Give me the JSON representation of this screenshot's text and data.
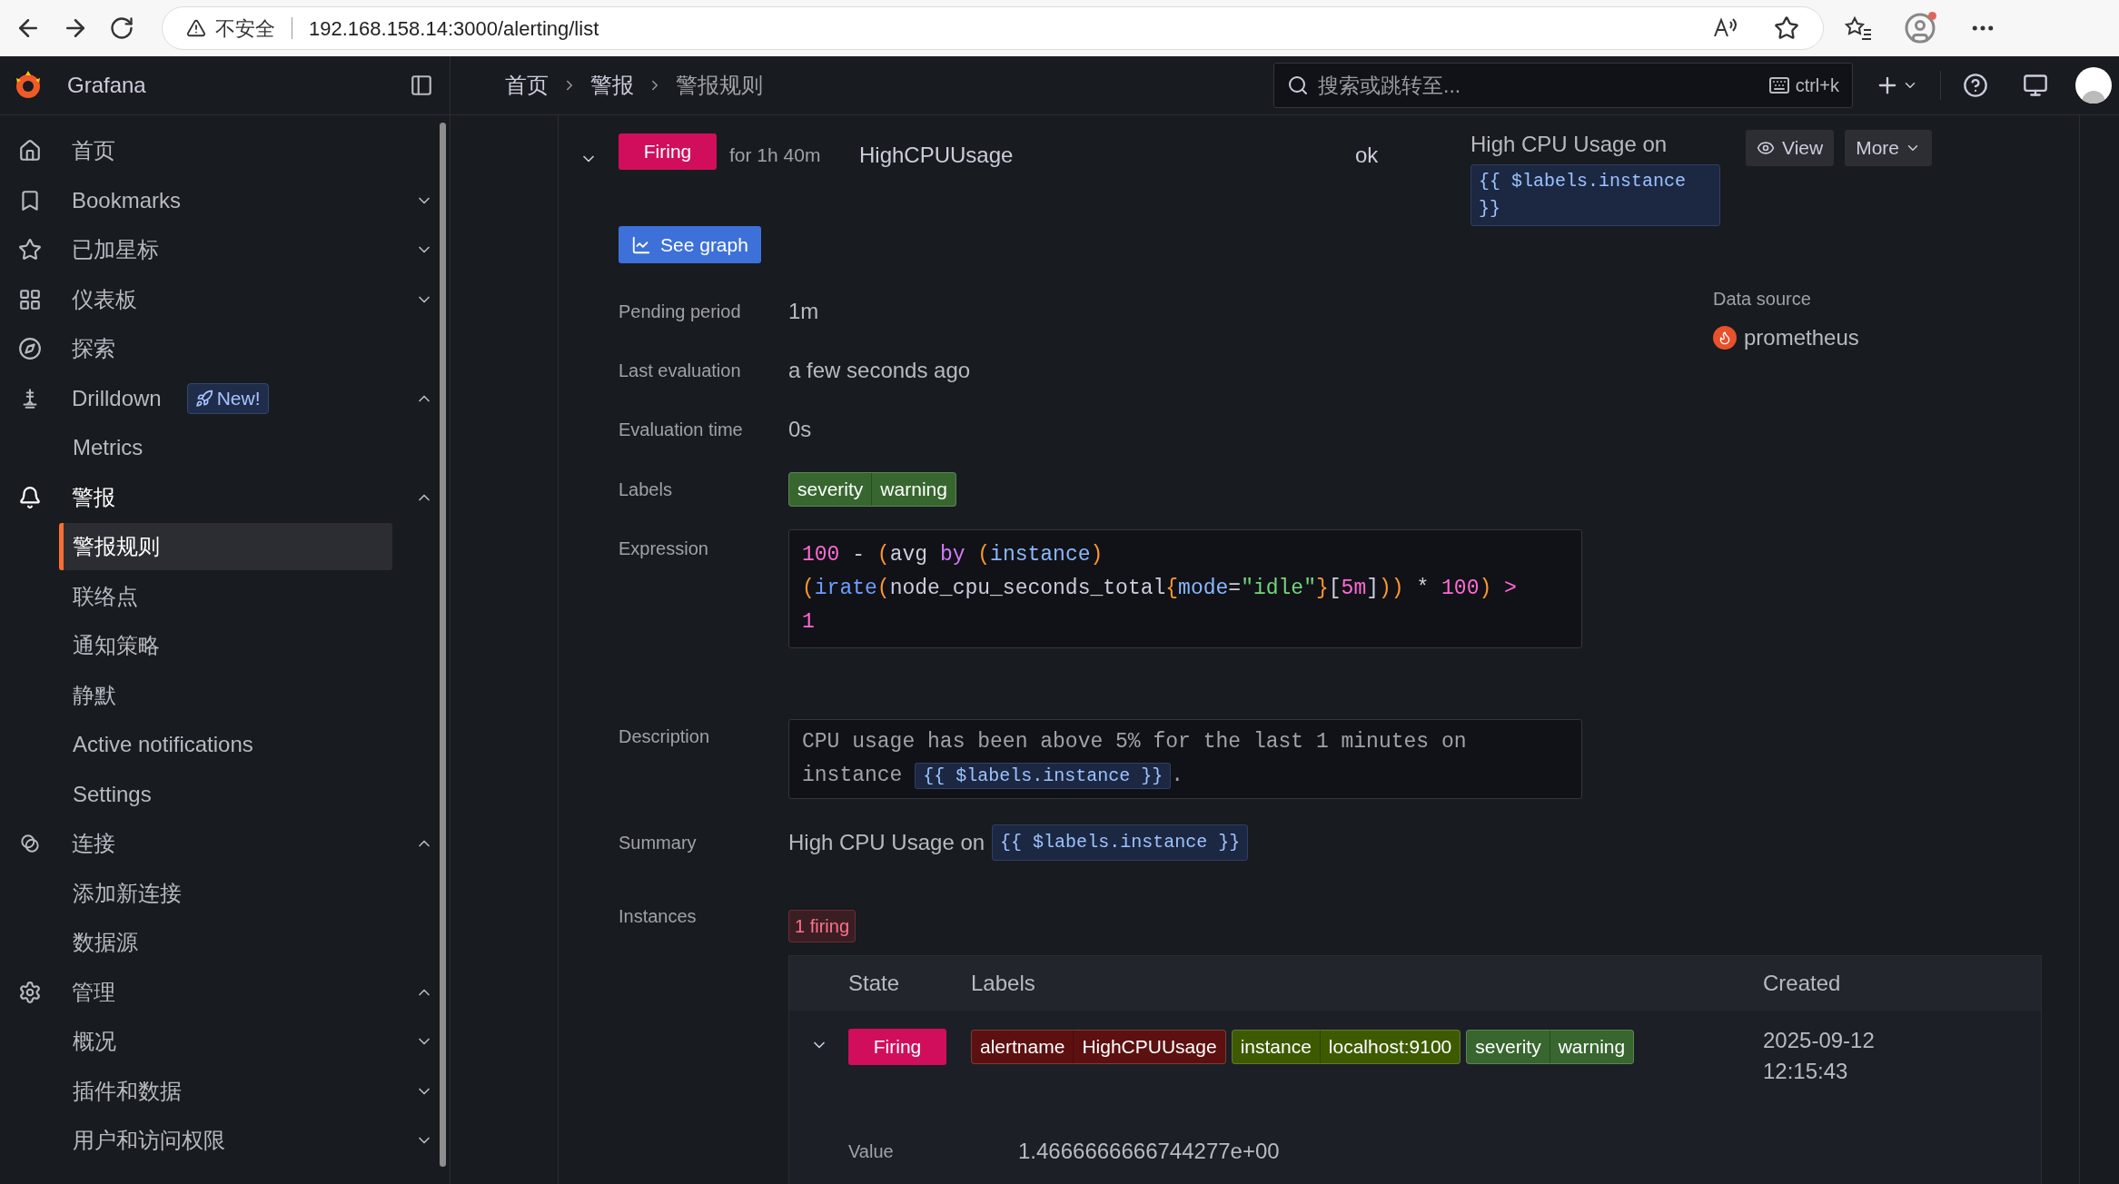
{
  "browser": {
    "security": "不安全",
    "url": "192.168.158.14:3000/alerting/list"
  },
  "header": {
    "app_name": "Grafana",
    "breadcrumbs": [
      "首页",
      "警报",
      "警报规则"
    ],
    "search": {
      "placeholder": "搜索或跳转至..."
    },
    "shortcut": "ctrl+k"
  },
  "sidebar": {
    "items": [
      {
        "label": "首页",
        "selected": false
      },
      {
        "label": "Bookmarks",
        "selected": false,
        "expanded": false
      },
      {
        "label": "已加星标",
        "selected": false,
        "expanded": false
      },
      {
        "label": "仪表板",
        "selected": false,
        "expanded": false
      },
      {
        "label": "探索",
        "selected": false
      },
      {
        "label": "Drilldown",
        "selected": false,
        "badge": "New!",
        "expanded": true,
        "children": [
          {
            "label": "Metrics",
            "selected": false
          }
        ]
      },
      {
        "label": "警报",
        "selected": true,
        "expanded": true,
        "children": [
          {
            "label": "警报规则",
            "selected": true
          },
          {
            "label": "联络点",
            "selected": false
          },
          {
            "label": "通知策略",
            "selected": false
          },
          {
            "label": "静默",
            "selected": false
          },
          {
            "label": "Active notifications",
            "selected": false
          },
          {
            "label": "Settings",
            "selected": false
          }
        ]
      },
      {
        "label": "连接",
        "selected": false,
        "expanded": true,
        "children": [
          {
            "label": "添加新连接",
            "selected": false
          },
          {
            "label": "数据源",
            "selected": false
          }
        ]
      },
      {
        "label": "管理",
        "selected": false,
        "expanded": true,
        "children": [
          {
            "label": "概况",
            "selected": false,
            "expanded": false
          },
          {
            "label": "插件和数据",
            "selected": false,
            "expanded": false
          },
          {
            "label": "用户和访问权限",
            "selected": false,
            "expanded": false
          }
        ]
      }
    ]
  },
  "rule": {
    "expanded": true,
    "state": "Firing",
    "duration": "for 1h 40m",
    "name": "HighCPUUsage",
    "health": "ok",
    "summary_text": "High CPU Usage on",
    "summary_code": "{{ $labels.instance }}",
    "buttons": [
      "View",
      "More"
    ],
    "see_graph": "See graph",
    "fields": [
      {
        "label": "Pending period",
        "value": "1m"
      },
      {
        "label": "Last evaluation",
        "value": "a few seconds ago"
      },
      {
        "label": "Evaluation time",
        "value": "0s"
      }
    ],
    "labels_label": "Labels",
    "labels": [
      {
        "key": "severity",
        "value": "warning"
      }
    ],
    "expression_label": "Expression",
    "expression": [
      {
        "text": "100",
        "kind": "number"
      },
      {
        "text": " - ",
        "kind": "plain"
      },
      {
        "text": "(",
        "kind": "paren"
      },
      {
        "text": "avg ",
        "kind": "plain"
      },
      {
        "text": "by",
        "kind": "keyword"
      },
      {
        "text": " (",
        "kind": "paren"
      },
      {
        "text": "instance",
        "kind": "label"
      },
      {
        "text": ") (",
        "kind": "paren"
      },
      {
        "text": "irate",
        "kind": "func"
      },
      {
        "text": "(",
        "kind": "paren"
      },
      {
        "text": "node_cpu_seconds_total",
        "kind": "plain"
      },
      {
        "text": "{",
        "kind": "paren"
      },
      {
        "text": "mode",
        "kind": "label"
      },
      {
        "text": "=",
        "kind": "plain"
      },
      {
        "text": "\"idle\"",
        "kind": "string"
      },
      {
        "text": "}",
        "kind": "paren"
      },
      {
        "text": "[",
        "kind": "plain"
      },
      {
        "text": "5m",
        "kind": "number"
      },
      {
        "text": "]",
        "kind": "plain"
      },
      {
        "text": ")) ",
        "kind": "paren"
      },
      {
        "text": "* ",
        "kind": "plain"
      },
      {
        "text": "100",
        "kind": "number"
      },
      {
        "text": ") ",
        "kind": "paren"
      },
      {
        "text": "> 1",
        "kind": "number"
      }
    ],
    "description_label": "Description",
    "description_text": "CPU usage has been above 5% for the last 1 minutes on instance",
    "description_code": "{{ $labels.instance }}",
    "description_end": ".",
    "summary_label": "Summary",
    "summary_value": "High CPU Usage on",
    "summary_value_code": "{{ $labels.instance }}",
    "data_source_label": "Data source",
    "data_source": "prometheus",
    "instances_label": "Instances",
    "instances_badge": "1 firing",
    "instances": {
      "columns": [
        "State",
        "Labels",
        "Created"
      ],
      "rows": [
        {
          "expanded": true,
          "state": "Firing",
          "labels": [
            {
              "key": "alertname",
              "value": "HighCPUUsage",
              "color": "#5c1010"
            },
            {
              "key": "instance",
              "value": "localhost:9100",
              "color": "#3e5a00"
            },
            {
              "key": "severity",
              "value": "warning",
              "color": "#37672f"
            }
          ],
          "created": "2025-09-12 12:15:43",
          "value_label": "Value",
          "value": "1.4666666666744277e+00"
        }
      ]
    }
  }
}
